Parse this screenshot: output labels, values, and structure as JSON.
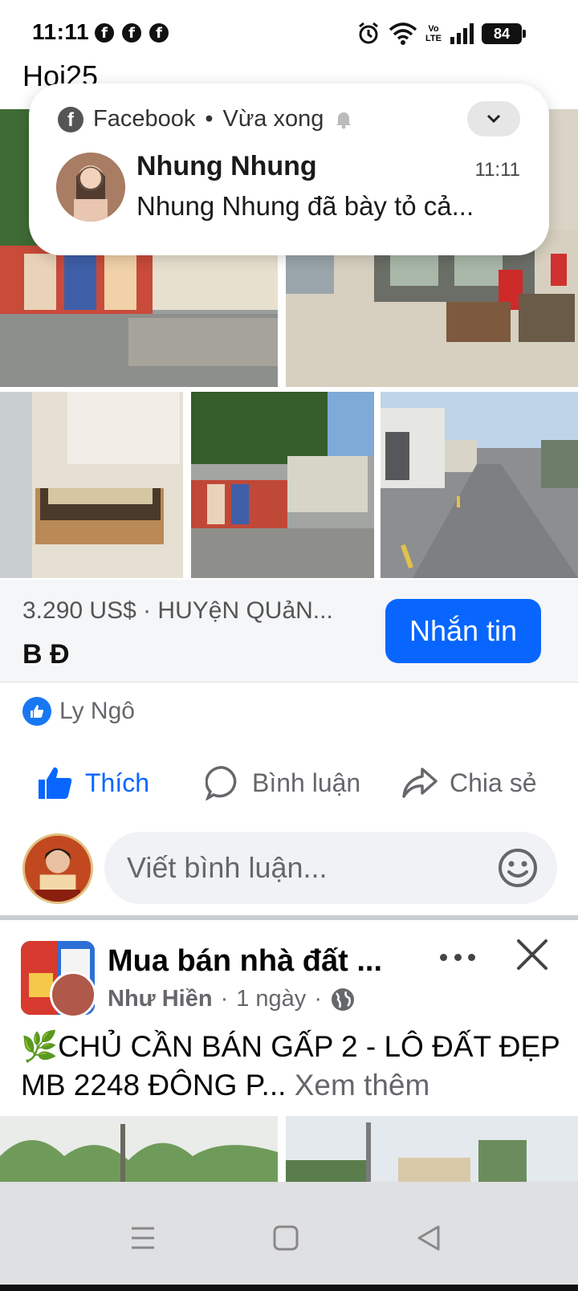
{
  "status_bar": {
    "time": "11:11",
    "battery": "84",
    "network": "VoLTE"
  },
  "prev_text": "Hoi25",
  "notification": {
    "app": "Facebook",
    "separator": "•",
    "when": "Vừa xong",
    "title": "Nhung Nhung",
    "time": "11:11",
    "body": "Nhung Nhung đã bày tỏ cả..."
  },
  "listing": {
    "price_location": "3.290 US$ · HUYệN QUảN...",
    "title": "B Đ",
    "message_button": "Nhắn tin"
  },
  "liker": "Ly Ngô",
  "actions": {
    "like": "Thích",
    "comment": "Bình luận",
    "share": "Chia sẻ"
  },
  "comment_box": {
    "placeholder": "Viết bình luận..."
  },
  "next_post": {
    "group_name": "Mua bán nhà đất ...",
    "author": "Như Hiền",
    "time": "1 ngày",
    "dot": "·",
    "text": "🌿CHỦ CẦN BÁN GẤP 2 - LÔ ĐẤT ĐẸP MB 2248 ĐÔNG P...",
    "see_more": "Xem thêm"
  },
  "colors": {
    "accent": "#0866ff",
    "muted": "#65676b",
    "background": "#ffffff"
  }
}
